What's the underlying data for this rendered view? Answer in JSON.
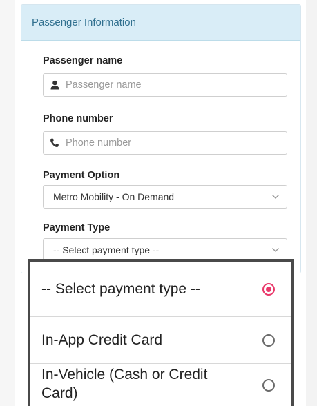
{
  "panel": {
    "title": "Passenger Information"
  },
  "fields": {
    "passenger_name": {
      "label": "Passenger name",
      "placeholder": "Passenger name",
      "icon": "user-icon"
    },
    "phone_number": {
      "label": "Phone number",
      "placeholder": "Phone number",
      "icon": "phone-icon"
    },
    "payment_option": {
      "label": "Payment Option",
      "value": "Metro Mobility - On Demand"
    },
    "payment_type": {
      "label": "Payment Type",
      "value": "-- Select payment type --"
    }
  },
  "picker": {
    "options": [
      {
        "label": "-- Select payment type --",
        "selected": true
      },
      {
        "label": "In-App Credit Card",
        "selected": false
      },
      {
        "label": "In-Vehicle (Cash or Credit Card)",
        "selected": false
      }
    ]
  },
  "colors": {
    "accent_radio": "#e9386a",
    "header_bg": "#d9edf7",
    "header_text": "#31708f"
  }
}
